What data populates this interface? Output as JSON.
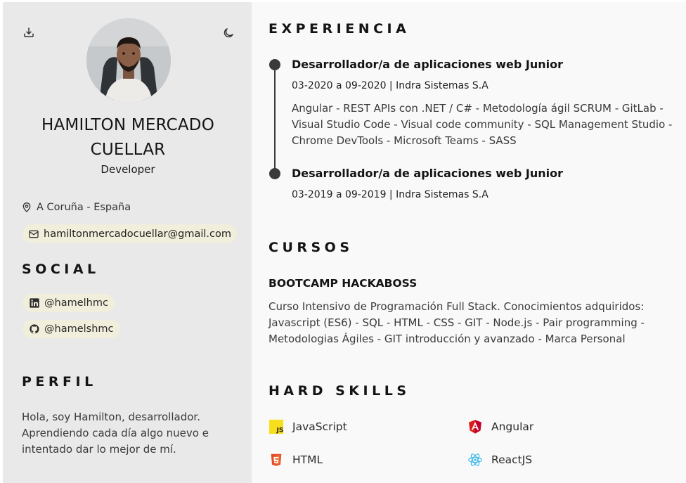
{
  "profile": {
    "name": "HAMILTON MERCADO CUELLAR",
    "role": "Developer",
    "location": "A Coruña - España",
    "email": "hamiltonmercadocuellar@gmail.com"
  },
  "icons": {
    "download": "download-icon",
    "theme": "moon-icon",
    "location": "map-pin-icon",
    "email": "mail-icon",
    "linkedin": "linkedin-icon",
    "github": "github-icon"
  },
  "social": {
    "title": "SOCIAL",
    "items": [
      {
        "network": "linkedin",
        "handle": "@hamelhmc"
      },
      {
        "network": "github",
        "handle": "@hamelshmc"
      }
    ]
  },
  "perfil": {
    "title": "PERFIL",
    "text": "Hola, soy Hamilton, desarrollador. Aprendiendo cada día algo nuevo e intentado dar lo mejor de mí."
  },
  "experience": {
    "title": "EXPERIENCIA",
    "jobs": [
      {
        "title": "Desarrollador/a de aplicaciones web Junior",
        "date": "03-2020 a 09-2020 | Indra Sistemas S.A",
        "description": "Angular - REST APIs con .NET / C# - Metodología ágil SCRUM - GitLab - Visual Studio Code - Visual code community - SQL Management Studio - Chrome DevTools - Microsoft Teams - SASS"
      },
      {
        "title": "Desarrollador/a de aplicaciones web Junior",
        "date": "03-2019 a 09-2019 | Indra Sistemas S.A",
        "description": ""
      }
    ]
  },
  "cursos": {
    "title": "CURSOS",
    "items": [
      {
        "name": "BOOTCAMP HACKABOSS",
        "description": "Curso Intensivo de Programación Full Stack. Conocimientos adquiridos: Javascript (ES6) - SQL - HTML - CSS - GIT - Node.js - Pair programming - Metodologias Ágiles - GIT introducción y avanzado - Marca Personal"
      }
    ]
  },
  "skills": {
    "title": "HARD SKILLS",
    "items": [
      {
        "label": "JavaScript",
        "icon": "javascript-icon",
        "color": "#f7df1e"
      },
      {
        "label": "Angular",
        "icon": "angular-icon",
        "color": "#dd1b16"
      },
      {
        "label": "HTML",
        "icon": "html5-icon",
        "color": "#e44d26"
      },
      {
        "label": "ReactJS",
        "icon": "react-icon",
        "color": "#61dafb"
      }
    ]
  },
  "colors": {
    "sidebar_bg": "#e9e9e9",
    "main_bg": "#f9f9f9",
    "chip_bg": "#f1eedb",
    "timeline": "#3a3a3a"
  }
}
